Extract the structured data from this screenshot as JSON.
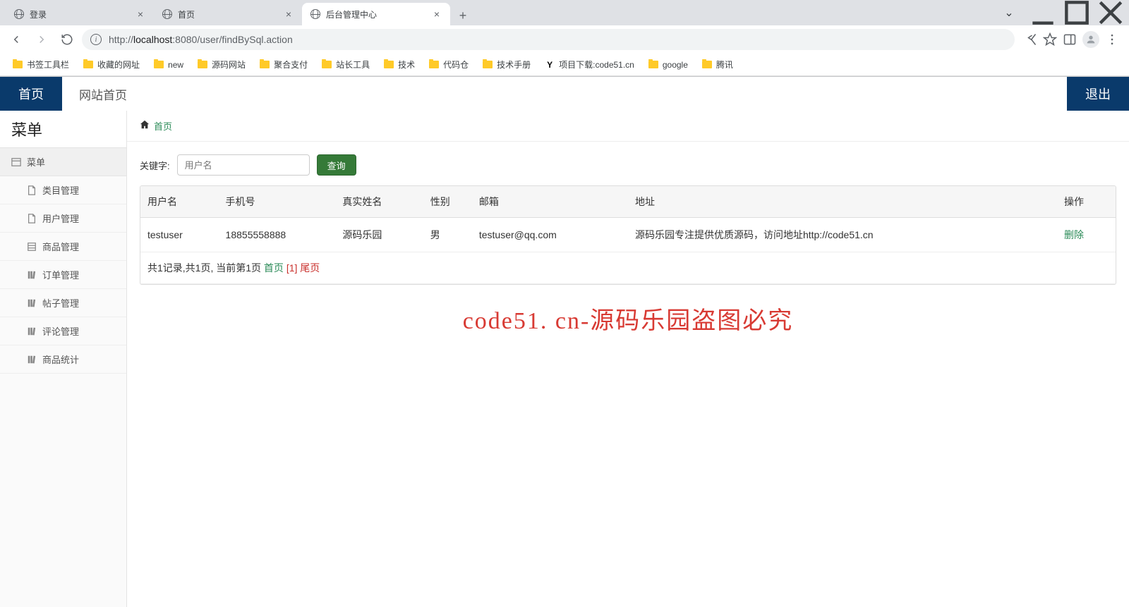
{
  "browser": {
    "tabs": [
      {
        "title": "登录"
      },
      {
        "title": "首页"
      },
      {
        "title": "后台管理中心"
      }
    ],
    "active_tab_index": 2,
    "url_prefix": "http://",
    "url_host": "localhost",
    "url_rest": ":8080/user/findBySql.action",
    "bookmarks": [
      "书签工具栏",
      "收藏的网址",
      "new",
      "源码网站",
      "聚合支付",
      "站长工具",
      "技术",
      "代码仓",
      "技术手册",
      "项目下载:code51.cn",
      "google",
      "腾讯"
    ],
    "bookmark_special_index": 9
  },
  "header": {
    "home_tab": "首页",
    "site_home": "网站首页",
    "logout": "退出"
  },
  "sidebar": {
    "title": "菜单",
    "group": "菜单",
    "items": [
      {
        "label": "类目管理",
        "icon": "file"
      },
      {
        "label": "用户管理",
        "icon": "file"
      },
      {
        "label": "商品管理",
        "icon": "list"
      },
      {
        "label": "订单管理",
        "icon": "book"
      },
      {
        "label": "帖子管理",
        "icon": "book"
      },
      {
        "label": "评论管理",
        "icon": "book"
      },
      {
        "label": "商品统计",
        "icon": "book"
      }
    ]
  },
  "breadcrumb": {
    "home": "首页"
  },
  "search": {
    "label": "关键字:",
    "placeholder": "用户名",
    "button": "查询"
  },
  "table": {
    "headers": [
      "用户名",
      "手机号",
      "真实姓名",
      "性别",
      "邮箱",
      "地址",
      "操作"
    ],
    "rows": [
      {
        "username": "testuser",
        "phone": "18855558888",
        "realname": "源码乐园",
        "gender": "男",
        "email": "testuser@qq.com",
        "address": "源码乐园专注提供优质源码，访问地址http://code51.cn",
        "action": "删除"
      }
    ],
    "pager": {
      "summary": "共1记录,共1页, 当前第1页",
      "first": "首页",
      "current": "[1]",
      "last": "尾页"
    }
  },
  "watermark": "code51. cn-源码乐园盗图必究"
}
